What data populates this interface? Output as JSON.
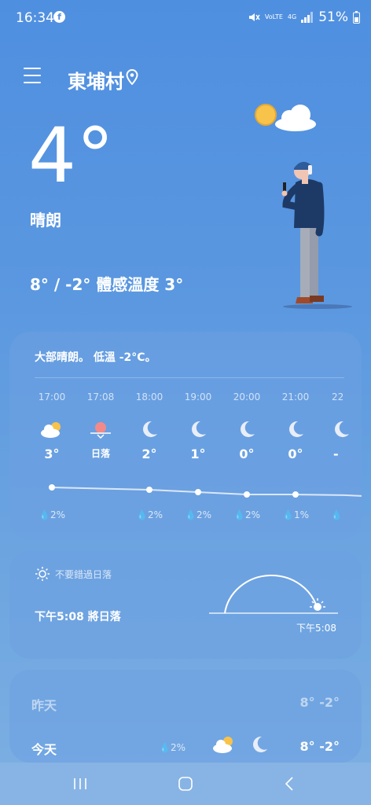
{
  "status_bar": {
    "time": "16:34",
    "network_labels": [
      "VoLTE",
      "4G"
    ],
    "battery": "51%"
  },
  "header": {
    "location": "東埔村"
  },
  "current": {
    "temperature": "4°",
    "condition": "晴朗",
    "hilo_feels": "8° / -2° 體感溫度 3°"
  },
  "hourly": {
    "summary": "大部晴朗。 低溫 -2°C。",
    "items": [
      {
        "time": "17:00",
        "icon": "partly-cloudy-icon",
        "temp": "3°",
        "precip": "2%",
        "value": 3
      },
      {
        "time": "17:08",
        "icon": "sunset-icon",
        "temp": "日落",
        "precip": "",
        "value": null
      },
      {
        "time": "18:00",
        "icon": "moon-icon",
        "temp": "2°",
        "precip": "2%",
        "value": 2
      },
      {
        "time": "19:00",
        "icon": "moon-icon",
        "temp": "1°",
        "precip": "2%",
        "value": 1
      },
      {
        "time": "20:00",
        "icon": "moon-icon",
        "temp": "0°",
        "precip": "2%",
        "value": 0
      },
      {
        "time": "21:00",
        "icon": "moon-icon",
        "temp": "0°",
        "precip": "1%",
        "value": 0
      },
      {
        "time": "22",
        "icon": "moon-icon",
        "temp": "-",
        "precip": "",
        "value": -0.3
      }
    ]
  },
  "sunset": {
    "hint": "不要錯過日落",
    "title": "下午5:08 將日落",
    "time": "下午5:08"
  },
  "daily": [
    {
      "day": "昨天",
      "hilo": "8° -2°",
      "precip": ""
    },
    {
      "day": "今天",
      "hilo": "8° -2°",
      "precip": "2%"
    }
  ],
  "colors": {
    "sun": "#f8c34a",
    "sunset": "#f28a8a",
    "jacket": "#1d3a66",
    "pants": "#a6acb8"
  }
}
